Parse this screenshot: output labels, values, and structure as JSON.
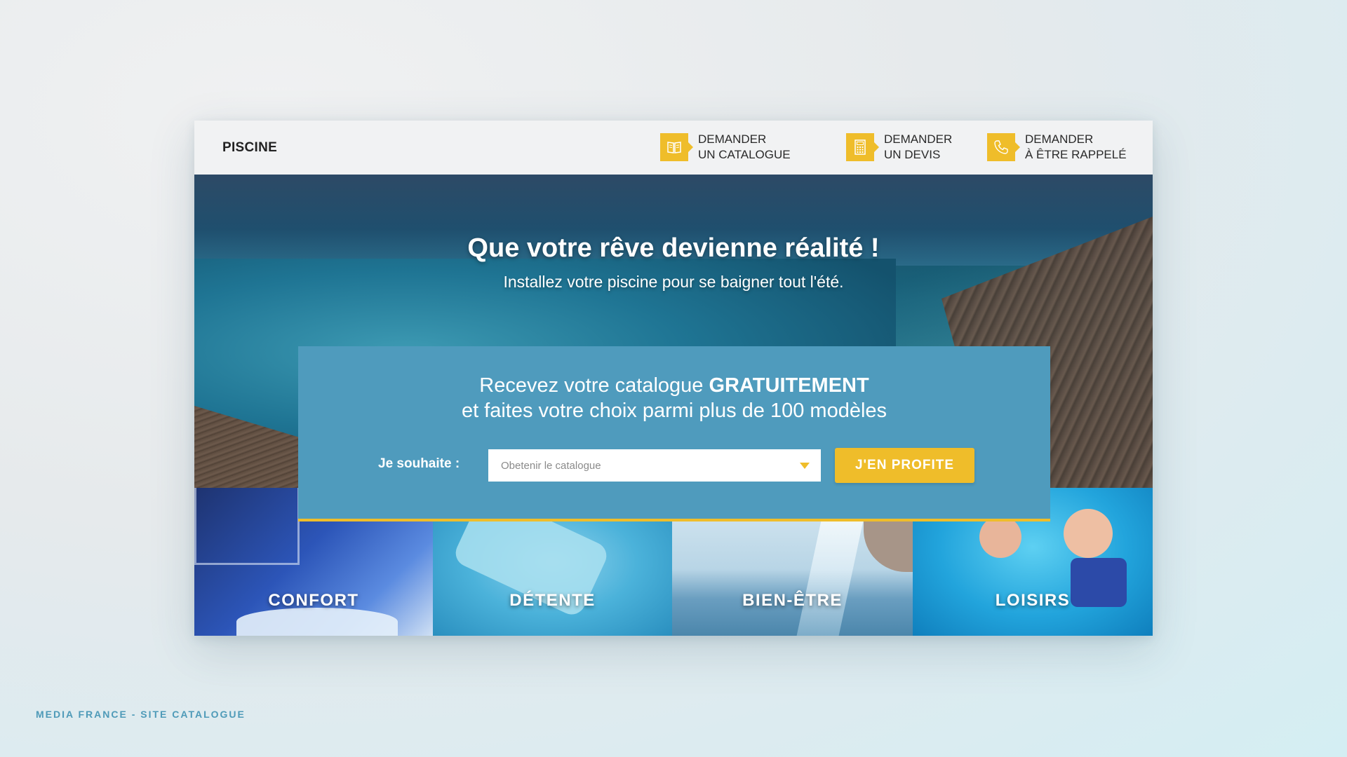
{
  "header": {
    "brand": "PISCINE",
    "nav": [
      {
        "line1": "DEMANDER",
        "line2": "UN CATALOGUE",
        "icon": "catalogue-icon"
      },
      {
        "line1": "DEMANDER",
        "line2": "UN DEVIS",
        "icon": "calculator-icon"
      },
      {
        "line1": "DEMANDER",
        "line2": "À ÊTRE RAPPELÉ",
        "icon": "phone-icon"
      }
    ]
  },
  "hero": {
    "title": "Que votre rêve devienne réalité !",
    "subtitle": "Installez votre piscine pour se baigner tout l'été."
  },
  "form": {
    "line1_prefix": "Recevez votre catalogue ",
    "line1_bold": "GRATUITEMENT",
    "line2": "et faites votre choix parmi plus de 100 modèles",
    "label": "Je souhaite :",
    "select_value": "Obetenir le catalogue",
    "button": "J'EN PROFITE"
  },
  "tiles": [
    {
      "label": "CONFORT"
    },
    {
      "label": "DÉTENTE"
    },
    {
      "label": "BIEN-ÊTRE"
    },
    {
      "label": "LOISIRS"
    }
  ],
  "caption": "MEDIA FRANCE - SITE CATALOGUE",
  "colors": {
    "accent": "#efbd2a",
    "form_bg": "#4f9bbd",
    "caption": "#4e9ab8"
  }
}
